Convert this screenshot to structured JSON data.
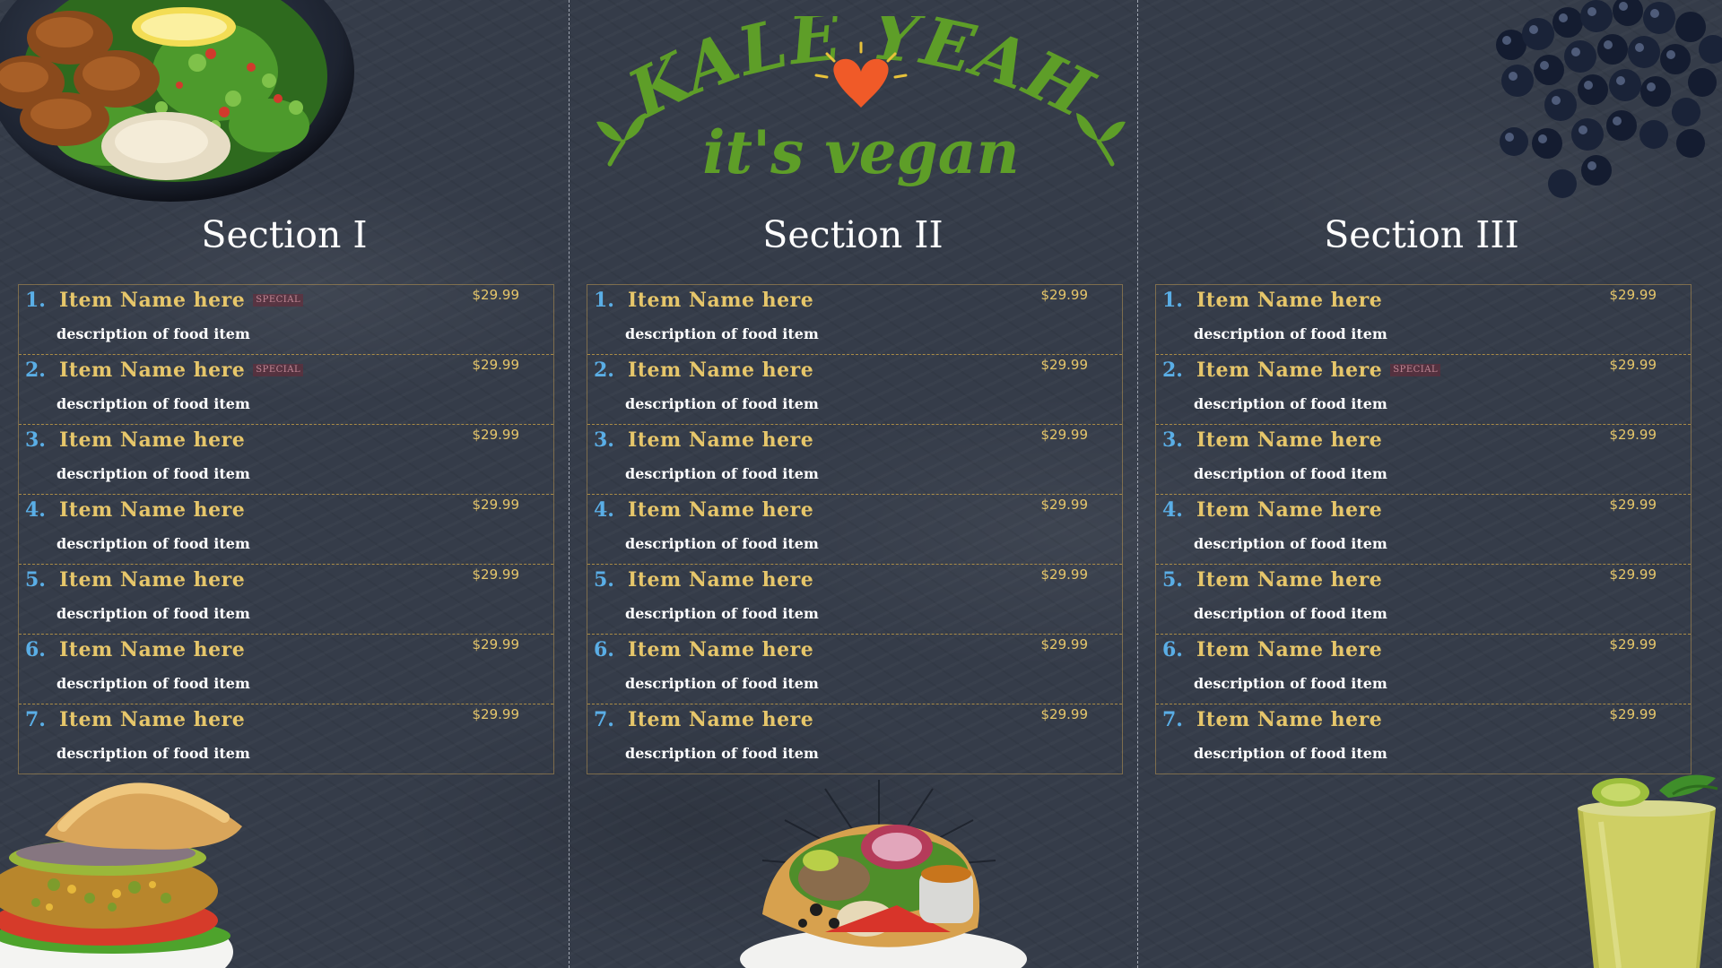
{
  "logo": {
    "line1": "KALE YEAH",
    "line2": "it's vegan",
    "colors": {
      "green": "#5e9e28",
      "heart": "#f05a28"
    }
  },
  "colors": {
    "background": "#353c49",
    "item_name": "#e6c66a",
    "item_number": "#5aaee6",
    "description": "#ffffff",
    "special_badge": "#c08795"
  },
  "sections": [
    {
      "title": "Section I",
      "items": [
        {
          "num": "1.",
          "name": "Item Name here",
          "special": "SPECIAL",
          "price": "$29.99",
          "desc": "description of food item"
        },
        {
          "num": "2.",
          "name": "Item Name here",
          "special": "SPECIAL",
          "price": "$29.99",
          "desc": "description of food item"
        },
        {
          "num": "3.",
          "name": "Item Name here",
          "special": "",
          "price": "$29.99",
          "desc": "description of food item"
        },
        {
          "num": "4.",
          "name": "Item Name here",
          "special": "",
          "price": "$29.99",
          "desc": "description of food item"
        },
        {
          "num": "5.",
          "name": "Item Name here",
          "special": "",
          "price": "$29.99",
          "desc": "description of food item"
        },
        {
          "num": "6.",
          "name": "Item Name here",
          "special": "",
          "price": "$29.99",
          "desc": "description of food item"
        },
        {
          "num": "7.",
          "name": "Item Name here",
          "special": "",
          "price": "$29.99",
          "desc": "description of food item"
        }
      ]
    },
    {
      "title": "Section II",
      "items": [
        {
          "num": "1.",
          "name": "Item Name here",
          "special": "",
          "price": "$29.99",
          "desc": "description of food item"
        },
        {
          "num": "2.",
          "name": "Item Name here",
          "special": "",
          "price": "$29.99",
          "desc": "description of food item"
        },
        {
          "num": "3.",
          "name": "Item Name here",
          "special": "",
          "price": "$29.99",
          "desc": "description of food item"
        },
        {
          "num": "4.",
          "name": "Item Name here",
          "special": "",
          "price": "$29.99",
          "desc": "description of food item"
        },
        {
          "num": "5.",
          "name": "Item Name here",
          "special": "",
          "price": "$29.99",
          "desc": "description of food item"
        },
        {
          "num": "6.",
          "name": "Item Name here",
          "special": "",
          "price": "$29.99",
          "desc": "description of food item"
        },
        {
          "num": "7.",
          "name": "Item Name here",
          "special": "",
          "price": "$29.99",
          "desc": "description of food item"
        }
      ]
    },
    {
      "title": "Section III",
      "items": [
        {
          "num": "1.",
          "name": "Item Name here",
          "special": "",
          "price": "$29.99",
          "desc": "description of food item"
        },
        {
          "num": "2.",
          "name": "Item Name here",
          "special": "SPECIAL",
          "price": "$29.99",
          "desc": "description of food item"
        },
        {
          "num": "3.",
          "name": "Item Name here",
          "special": "",
          "price": "$29.99",
          "desc": "description of food item"
        },
        {
          "num": "4.",
          "name": "Item Name here",
          "special": "",
          "price": "$29.99",
          "desc": "description of food item"
        },
        {
          "num": "5.",
          "name": "Item Name here",
          "special": "",
          "price": "$29.99",
          "desc": "description of food item"
        },
        {
          "num": "6.",
          "name": "Item Name here",
          "special": "",
          "price": "$29.99",
          "desc": "description of food item"
        },
        {
          "num": "7.",
          "name": "Item Name here",
          "special": "",
          "price": "$29.99",
          "desc": "description of food item"
        }
      ]
    }
  ],
  "photos": [
    "falafel-salad-plate",
    "blueberries",
    "veggie-burger",
    "taco-salad-bowl",
    "kiwi-smoothie"
  ]
}
